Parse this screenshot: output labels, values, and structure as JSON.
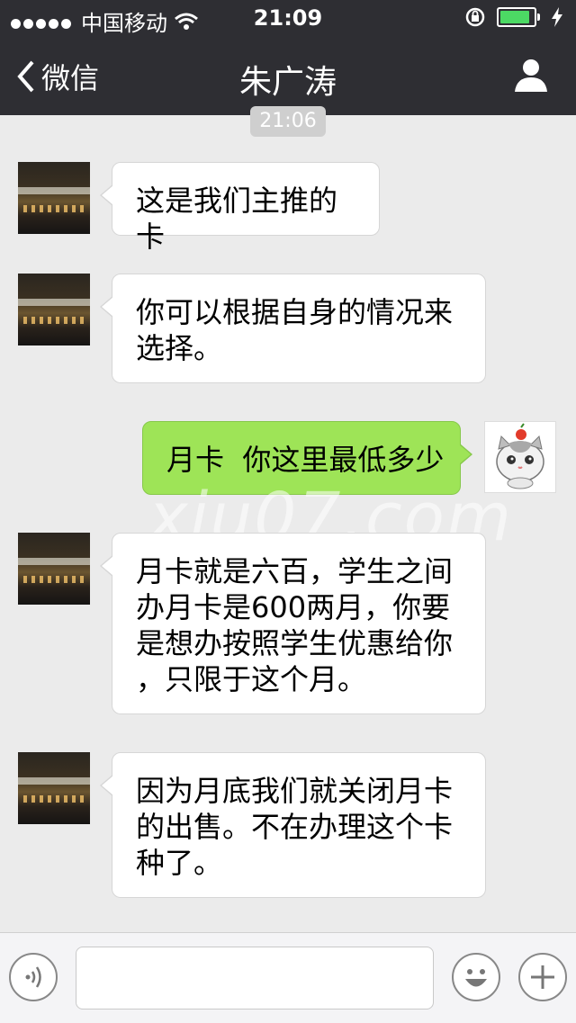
{
  "status_bar": {
    "carrier": "中国移动",
    "time": "21:09",
    "battery_level": 0.9
  },
  "nav": {
    "back_label": "微信",
    "title": "朱广涛"
  },
  "chat": {
    "timestamp": "21:06",
    "messages": [
      {
        "side": "left",
        "text": "这是我们主推的卡"
      },
      {
        "side": "left",
        "text": "你可以根据自身的情况来\n选择。"
      },
      {
        "side": "right",
        "text": "月卡  你这里最低多少"
      },
      {
        "side": "left",
        "text": "月卡就是六百，学生之间\n办月卡是600两月，你要\n是想办按照学生优惠给你\n，只限于这个月。"
      },
      {
        "side": "left",
        "text": "因为月底我们就关闭月卡\n的出售。不在办理这个卡\n种了。"
      }
    ]
  },
  "watermark": "xiu07.com",
  "input_bar": {
    "value": "",
    "placeholder": ""
  },
  "colors": {
    "nav_bg": "#2e2e33",
    "chat_bg": "#ebebeb",
    "sent_bubble": "#9ee457",
    "received_bubble": "#ffffff"
  },
  "icons": [
    "signal-dots-icon",
    "wifi-icon",
    "rotation-lock-icon",
    "battery-icon",
    "charging-icon",
    "back-chevron-icon",
    "profile-icon",
    "voice-icon",
    "emoji-icon",
    "plus-icon"
  ]
}
